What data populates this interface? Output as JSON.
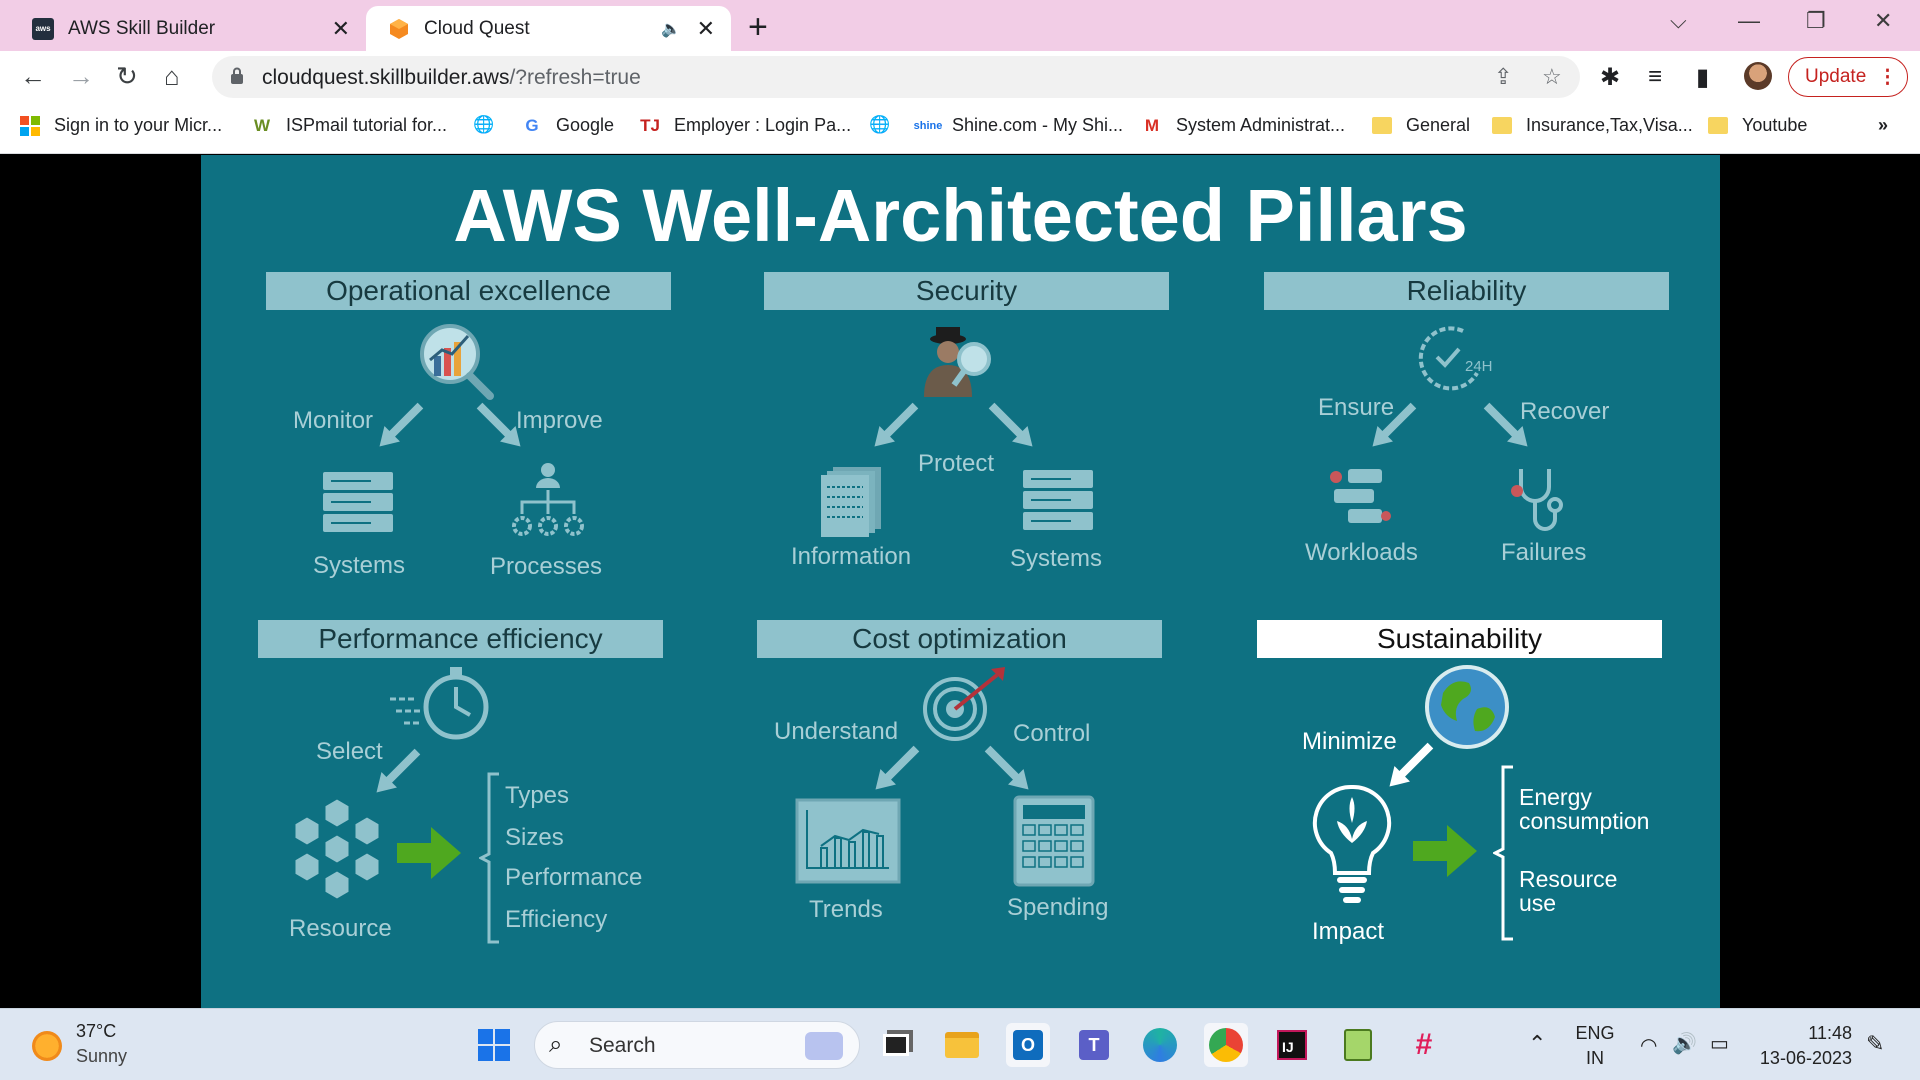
{
  "browser": {
    "tabs": [
      {
        "title": "AWS Skill Builder",
        "icon": "aws-icon",
        "active": false
      },
      {
        "title": "Cloud Quest",
        "icon": "cloud-quest-icon",
        "active": true
      }
    ],
    "url_host": "cloudquest.skillbuilder.aws",
    "url_rest": "/?refresh=true",
    "update_label": "Update",
    "bookmarks": [
      {
        "label": "Sign in to your Micr...",
        "icon": "microsoft-icon"
      },
      {
        "label": "ISPmail tutorial for...",
        "icon": "w-icon"
      },
      {
        "label": "",
        "icon": "globe-icon"
      },
      {
        "label": "Google",
        "icon": "google-icon"
      },
      {
        "label": "Employer : Login Pa...",
        "icon": "tj-icon"
      },
      {
        "label": "",
        "icon": "globe-icon"
      },
      {
        "label": "Shine.com - My Shi...",
        "icon": "shine-icon"
      },
      {
        "label": "System Administrat...",
        "icon": "gmail-icon"
      },
      {
        "label": "General",
        "icon": "folder-icon"
      },
      {
        "label": "Insurance,Tax,Visa...",
        "icon": "folder-icon"
      },
      {
        "label": "Youtube",
        "icon": "folder-icon"
      }
    ],
    "more": "»"
  },
  "slide": {
    "title": "AWS Well-Architected Pillars",
    "pillars": {
      "operational": {
        "title": "Operational excellence",
        "left": "Monitor",
        "right": "Improve",
        "out1": "Systems",
        "out2": "Processes"
      },
      "security": {
        "title": "Security",
        "center": "Protect",
        "out1": "Information",
        "out2": "Systems"
      },
      "reliability": {
        "title": "Reliability",
        "left": "Ensure",
        "right": "Recover",
        "out1": "Workloads",
        "out2": "Failures",
        "clock_text": "24H"
      },
      "performance": {
        "title": "Performance efficiency",
        "select": "Select",
        "resource": "Resource",
        "items": [
          "Types",
          "Sizes",
          "Performance",
          "Efficiency"
        ]
      },
      "cost": {
        "title": "Cost optimization",
        "left": "Understand",
        "right": "Control",
        "out1": "Trends",
        "out2": "Spending"
      },
      "sustainability": {
        "title": "Sustainability",
        "minimize": "Minimize",
        "impact": "Impact",
        "items": [
          "Energy consumption",
          "Resource use"
        ]
      }
    }
  },
  "taskbar": {
    "weather_temp": "37°C",
    "weather_desc": "Sunny",
    "search_label": "Search",
    "lang1": "ENG",
    "lang2": "IN",
    "time": "11:48",
    "date": "13-06-2023"
  },
  "colors": {
    "tabstrip": "#f2cde6",
    "slide_bg": "#0e7182",
    "pillar_box": "#8fc2cc",
    "arrow_green": "#4fa81f"
  }
}
